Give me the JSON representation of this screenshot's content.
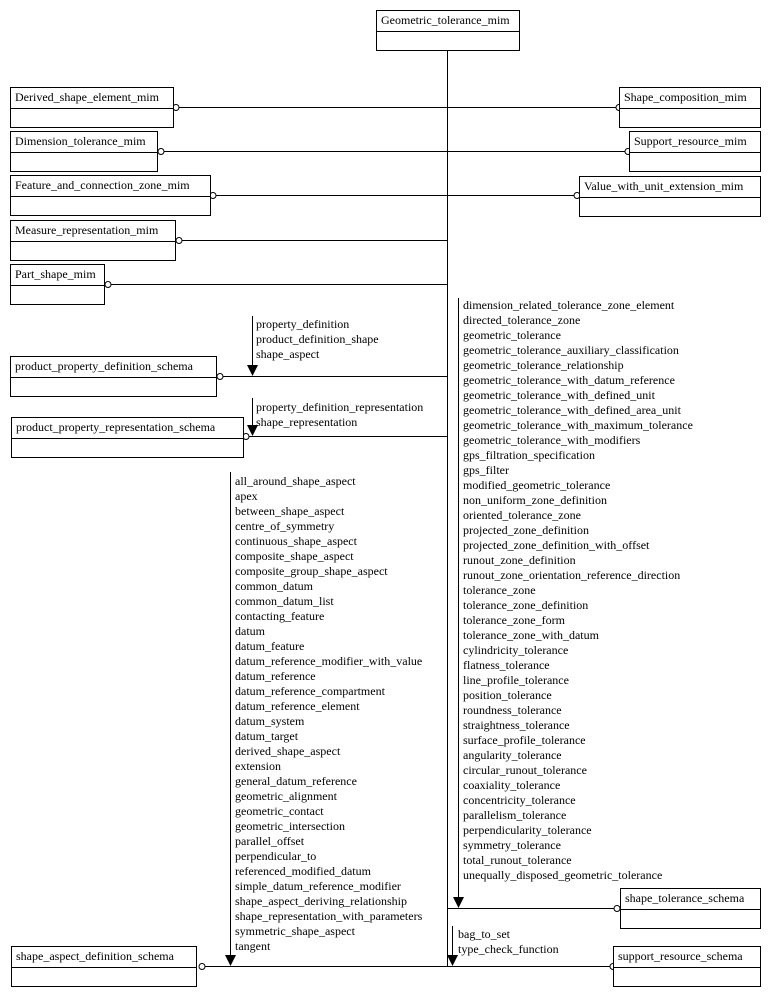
{
  "diagram": {
    "central_schema": "Geometric_tolerance_mim",
    "left_schemas": [
      "Derived_shape_element_mim",
      "Dimension_tolerance_mim",
      "Feature_and_connection_zone_mim",
      "Measure_representation_mim",
      "Part_shape_mim"
    ],
    "right_schemas": [
      "Shape_composition_mim",
      "Support_resource_mim",
      "Value_with_unit_extension_mim"
    ],
    "product_property_definition_schema": {
      "name": "product_property_definition_schema",
      "items": [
        "property_definition",
        "product_definition_shape",
        "shape_aspect"
      ]
    },
    "product_property_representation_schema": {
      "name": "product_property_representation_schema",
      "items": [
        "property_definition_representation",
        "shape_representation"
      ]
    },
    "shape_aspect_definition_schema": {
      "name": "shape_aspect_definition_schema",
      "items": [
        "all_around_shape_aspect",
        "apex",
        "between_shape_aspect",
        "centre_of_symmetry",
        "continuous_shape_aspect",
        "composite_shape_aspect",
        "composite_group_shape_aspect",
        "common_datum",
        "common_datum_list",
        "contacting_feature",
        "datum",
        "datum_feature",
        "datum_reference_modifier_with_value",
        "datum_reference",
        "datum_reference_compartment",
        "datum_reference_element",
        "datum_system",
        "datum_target",
        "derived_shape_aspect",
        "extension",
        "general_datum_reference",
        "geometric_alignment",
        "geometric_contact",
        "geometric_intersection",
        "parallel_offset",
        "perpendicular_to",
        "referenced_modified_datum",
        "simple_datum_reference_modifier",
        "shape_aspect_deriving_relationship",
        "shape_representation_with_parameters",
        "symmetric_shape_aspect",
        "tangent"
      ]
    },
    "shape_tolerance_schema": {
      "name": "shape_tolerance_schema",
      "items": [
        "dimension_related_tolerance_zone_element",
        "directed_tolerance_zone",
        "geometric_tolerance",
        "geometric_tolerance_auxiliary_classification",
        "geometric_tolerance_relationship",
        "geometric_tolerance_with_datum_reference",
        "geometric_tolerance_with_defined_unit",
        "geometric_tolerance_with_defined_area_unit",
        "geometric_tolerance_with_maximum_tolerance",
        "geometric_tolerance_with_modifiers",
        "gps_filtration_specification",
        "gps_filter",
        "modified_geometric_tolerance",
        "non_uniform_zone_definition",
        "oriented_tolerance_zone",
        "projected_zone_definition",
        "projected_zone_definition_with_offset",
        "runout_zone_definition",
        "runout_zone_orientation_reference_direction",
        "tolerance_zone",
        "tolerance_zone_definition",
        "tolerance_zone_form",
        "tolerance_zone_with_datum",
        "cylindricity_tolerance",
        "flatness_tolerance",
        "line_profile_tolerance",
        "position_tolerance",
        "roundness_tolerance",
        "straightness_tolerance",
        "surface_profile_tolerance",
        "angularity_tolerance",
        "circular_runout_tolerance",
        "coaxiality_tolerance",
        "concentricity_tolerance",
        "parallelism_tolerance",
        "perpendicularity_tolerance",
        "symmetry_tolerance",
        "total_runout_tolerance",
        "unequally_disposed_geometric_tolerance"
      ]
    },
    "support_resource_schema": {
      "name": "support_resource_schema",
      "items": [
        "bag_to_set",
        "type_check_function"
      ]
    }
  }
}
